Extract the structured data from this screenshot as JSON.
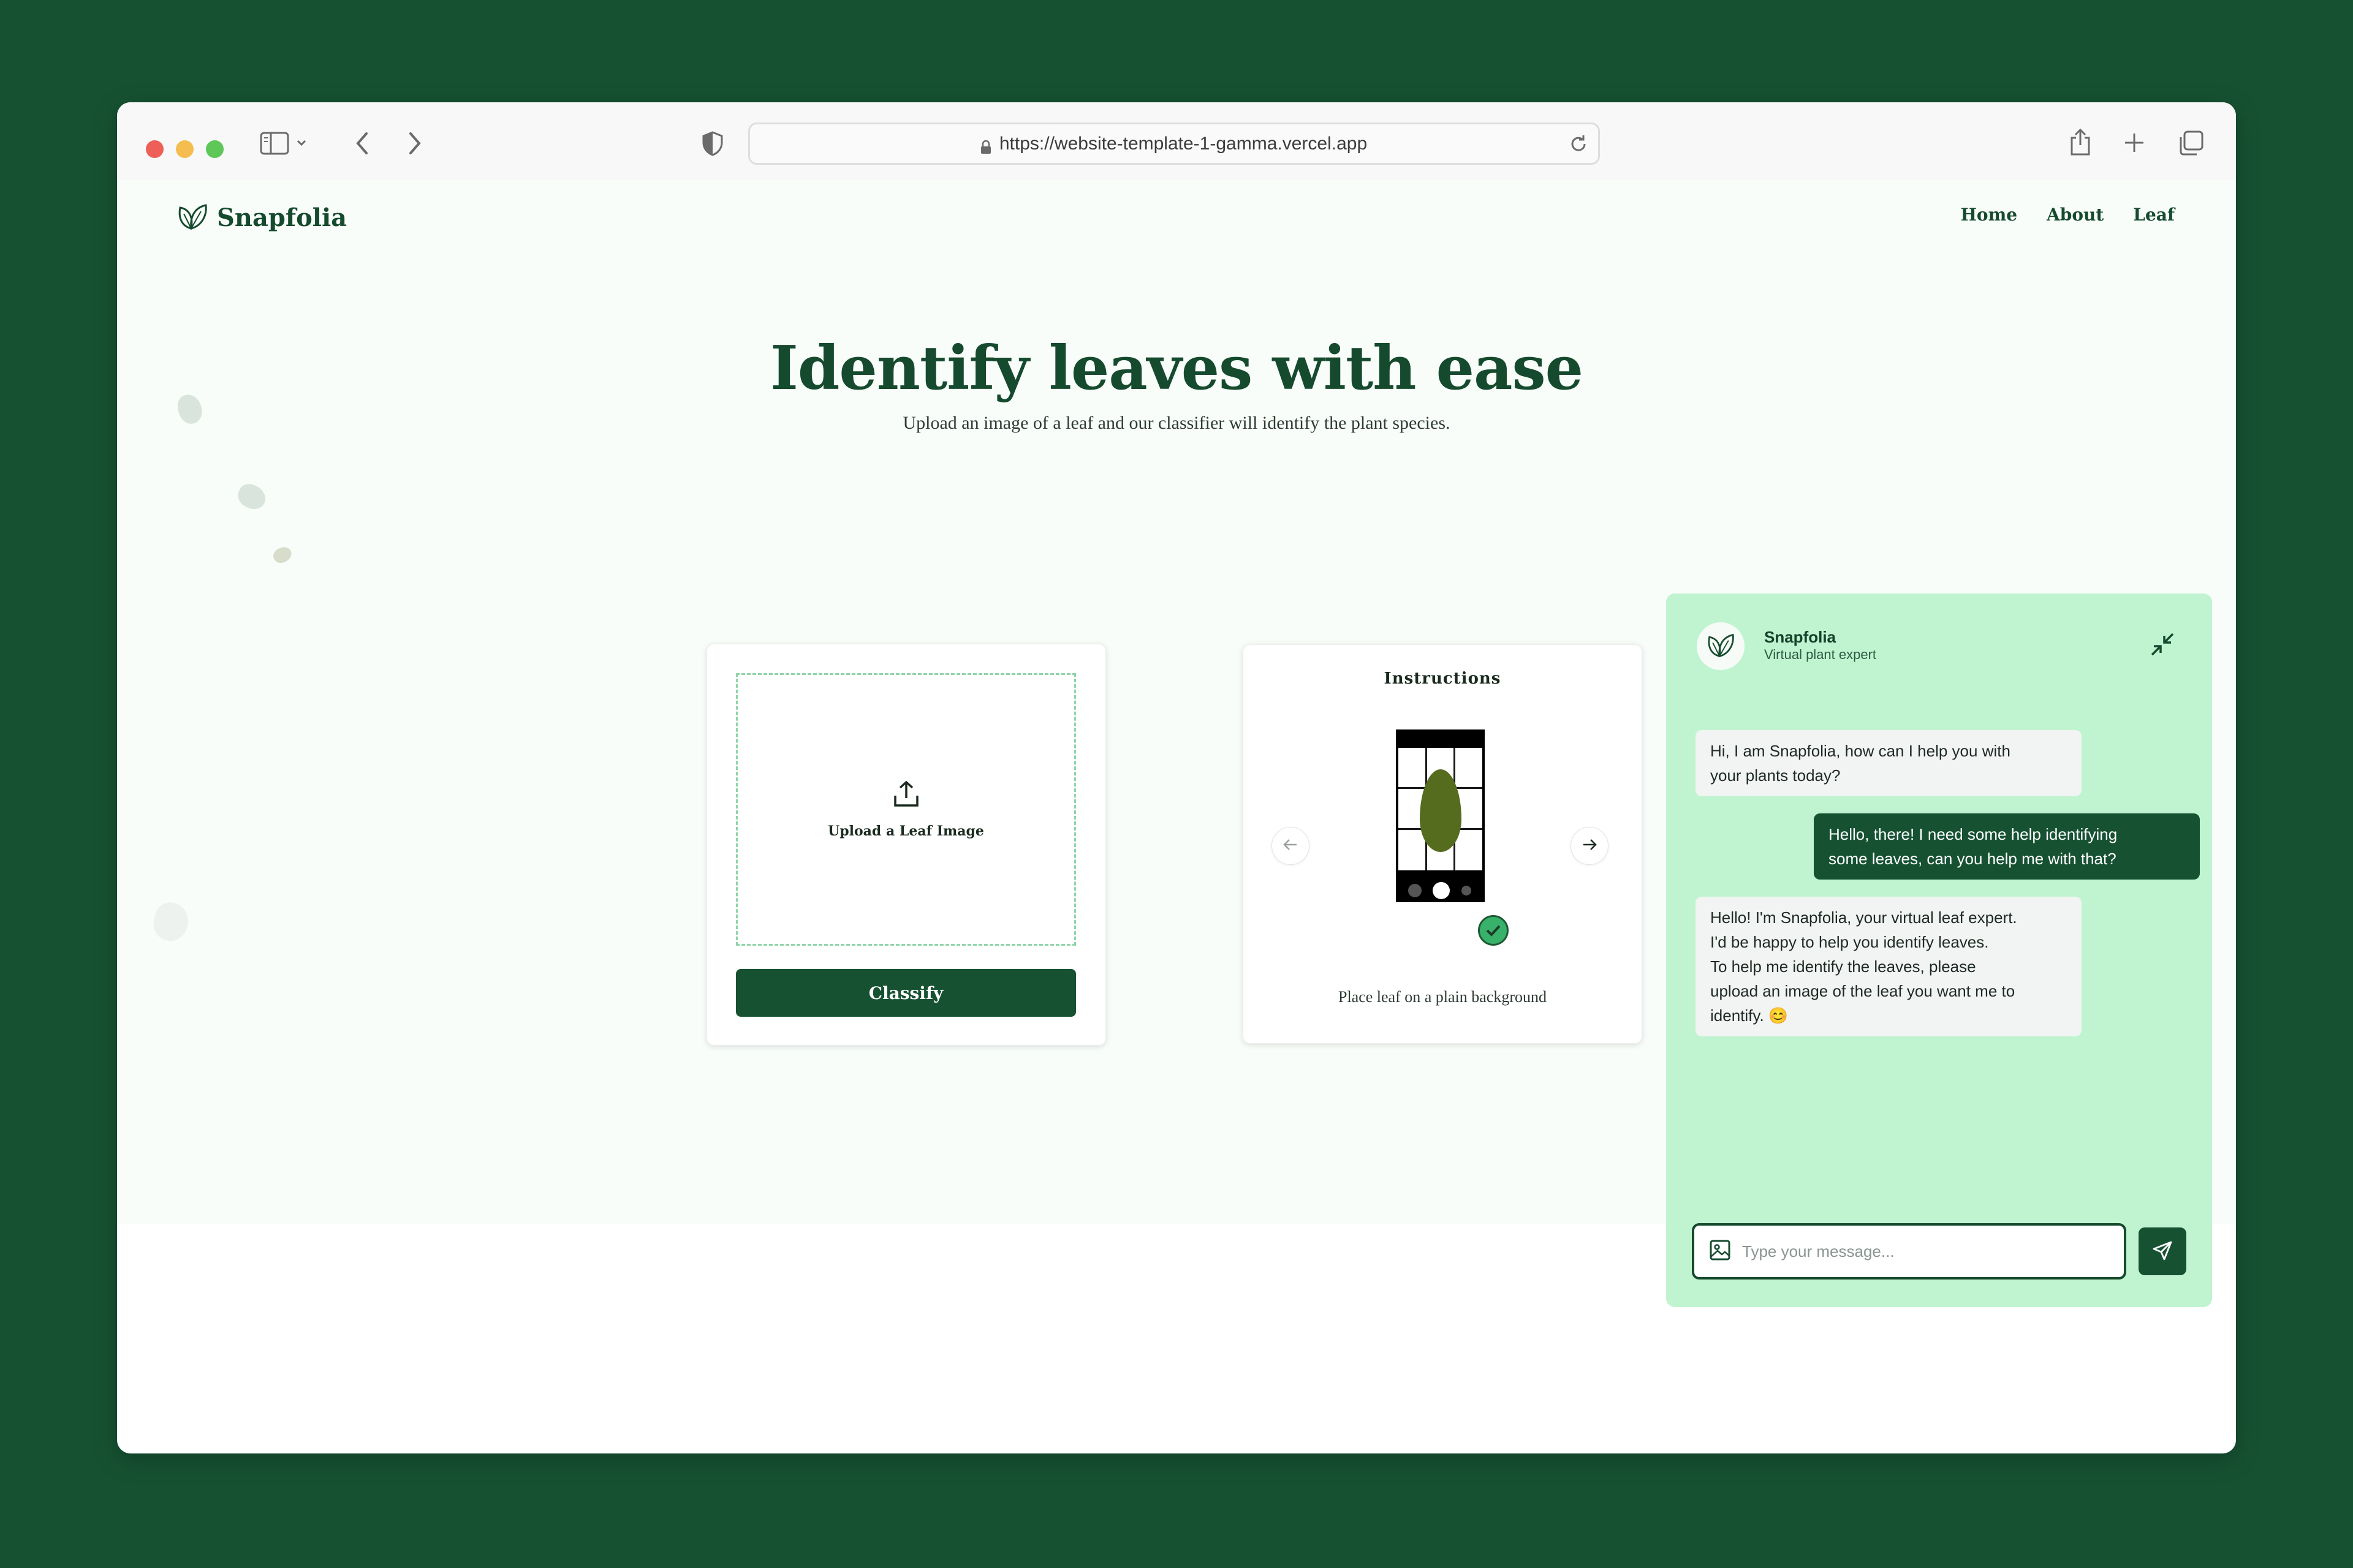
{
  "browser": {
    "url": "https://website-template-1-gamma.vercel.app"
  },
  "site": {
    "brand": "Snapfolia",
    "nav": [
      {
        "label": "Home"
      },
      {
        "label": "About"
      },
      {
        "label": "Leaf"
      }
    ]
  },
  "hero": {
    "title": "Identify leaves with ease",
    "subtitle": "Upload an image of a leaf and our classifier will identify the plant species."
  },
  "upload": {
    "label": "Upload a Leaf Image",
    "button": "Classify"
  },
  "instructions": {
    "title": "Instructions",
    "caption": "Place leaf on a plain background"
  },
  "chat": {
    "name": "Snapfolia",
    "role": "Virtual plant expert",
    "messages": [
      {
        "from": "bot",
        "lines": [
          "Hi, I am Snapfolia, how can I help you with",
          "your plants today?"
        ]
      },
      {
        "from": "user",
        "lines": [
          "Hello, there! I need some help identifying",
          "some leaves, can you help me with that?"
        ]
      },
      {
        "from": "bot",
        "lines": [
          "Hello! I'm Snapfolia, your virtual leaf expert.",
          "I'd be happy to help you identify leaves.",
          "To help me identify the leaves, please",
          "upload an image of the leaf you want me to",
          "identify. 😊"
        ]
      }
    ],
    "input_placeholder": "Type your message..."
  },
  "colors": {
    "brand_green": "#165232",
    "chat_bg": "#c0f4d0",
    "page_bg": "#f8fdf9"
  }
}
